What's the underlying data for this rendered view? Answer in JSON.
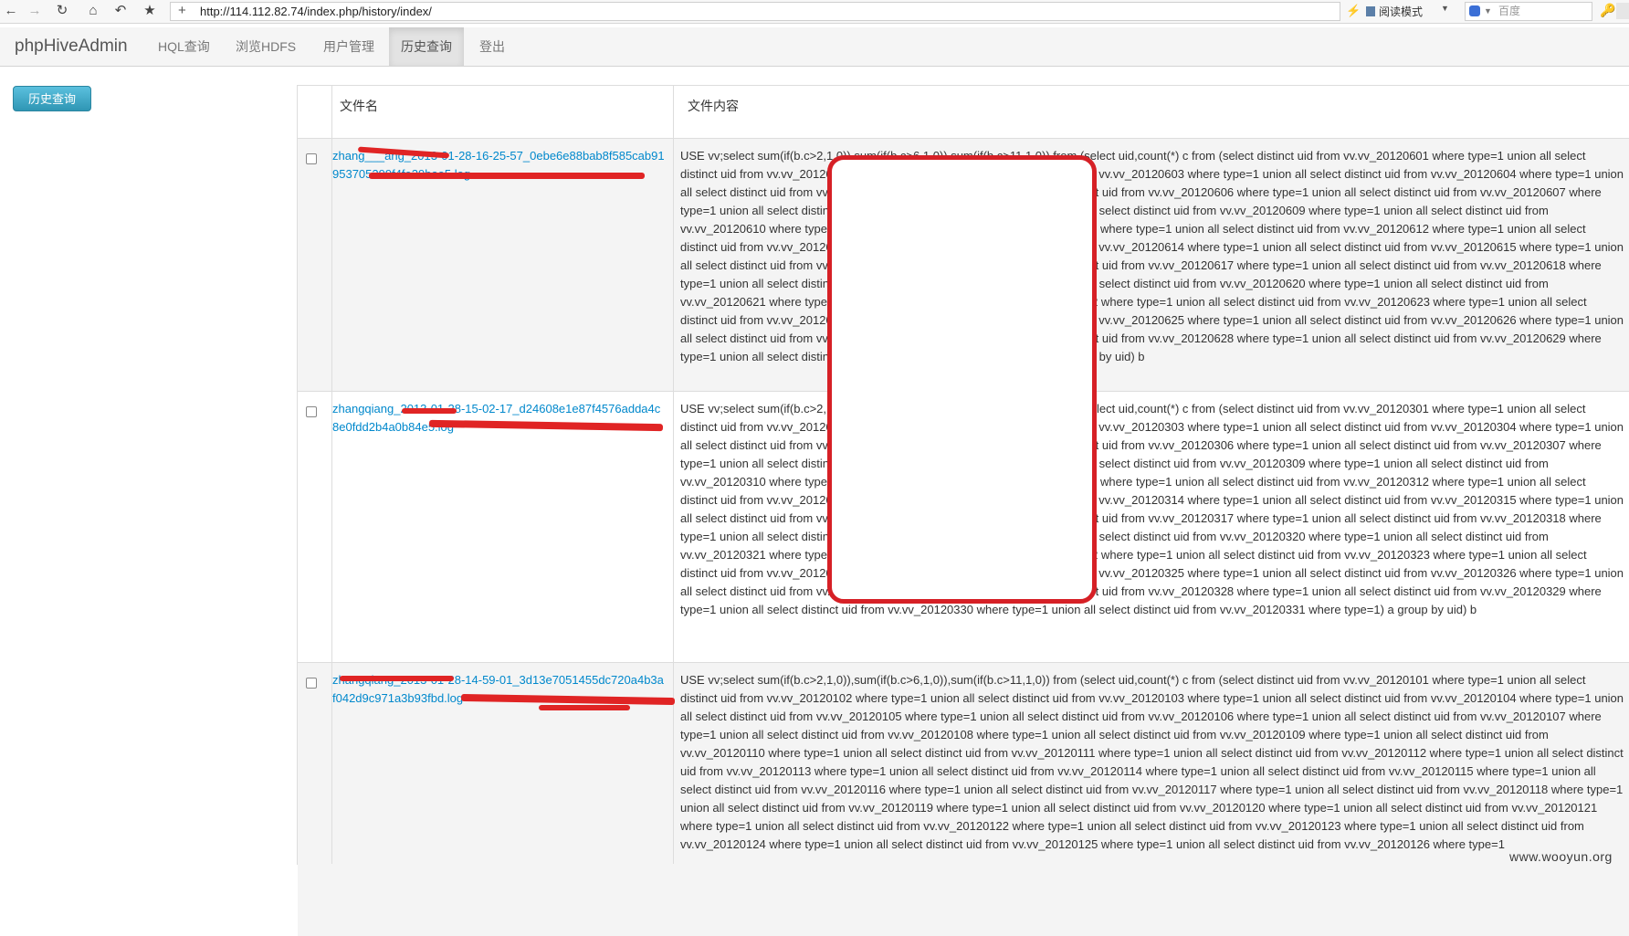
{
  "browser": {
    "url": "http://114.112.82.74/index.php/history/index/",
    "reader_mode_label": "阅读模式",
    "search_placeholder": "百度"
  },
  "navbar": {
    "brand": "phpHiveAdmin",
    "items": [
      {
        "label": "HQL查询",
        "active": false
      },
      {
        "label": "浏览HDFS",
        "active": false
      },
      {
        "label": "用户管理",
        "active": false
      },
      {
        "label": "历史查询",
        "active": true
      },
      {
        "label": "登出",
        "active": false
      }
    ]
  },
  "sidebar": {
    "button_label": "历史查询"
  },
  "table": {
    "headers": [
      "文件名",
      "文件内容"
    ],
    "rows": [
      {
        "file_name": "zhang___ang_2013-01-28-16-25-57_0ebe6e88bab8f585cab91953705299f4fe29bae5.log",
        "content": "USE vv;select sum(if(b.c>2,1,0)),sum(if(b.c>6,1,0)),sum(if(b.c>11,1,0)) from (select uid,count(*) c from (select distinct uid from vv.vv_20120601 where type=1 union all select distinct uid from vv.vv_20120602 where type=1 union all select distinct uid from vv.vv_20120603 where type=1 union all select distinct uid from vv.vv_20120604 where type=1 union all select distinct uid from vv.vv_20120605 where type=1 union all select distinct uid from vv.vv_20120606 where type=1 union all select distinct uid from vv.vv_20120607 where type=1 union all select distinct uid from vv.vv_20120608 where type=1 union all select distinct uid from vv.vv_20120609 where type=1 union all select distinct uid from vv.vv_20120610 where type=1 union all select distinct uid from vv.vv_20120611 where type=1 union all select distinct uid from vv.vv_20120612 where type=1 union all select distinct uid from vv.vv_20120613 where type=1 union all select distinct uid from vv.vv_20120614 where type=1 union all select distinct uid from vv.vv_20120615 where type=1 union all select distinct uid from vv.vv_20120616 where type=1 union all select distinct uid from vv.vv_20120617 where type=1 union all select distinct uid from vv.vv_20120618 where type=1 union all select distinct uid from vv.vv_20120619 where type=1 union all select distinct uid from vv.vv_20120620 where type=1 union all select distinct uid from vv.vv_20120621 where type=1 union all select distinct uid from vv.vv_20120622 where type=1 union all select distinct uid from vv.vv_20120623 where type=1 union all select distinct uid from vv.vv_20120624 where type=1 union all select distinct uid from vv.vv_20120625 where type=1 union all select distinct uid from vv.vv_20120626 where type=1 union all select distinct uid from vv.vv_20120627 where type=1 union all select distinct uid from vv.vv_20120628 where type=1 union all select distinct uid from vv.vv_20120629 where type=1 union all select distinct uid from vv.vv_20120630 where type=1) a group by uid) b"
      },
      {
        "file_name": "zhangqiang_2013-01-28-15-02-17_d24608e1e87f4576adda4c8e0fdd2b4a0b84e5.log",
        "content": "USE vv;select sum(if(b.c>2,1,0)),sum(if(b.c>6,1,0)),sum(if(b.c>11,1,0)) from (select uid,count(*) c from (select distinct uid from vv.vv_20120301 where type=1 union all select distinct uid from vv.vv_20120302 where type=1 union all select distinct uid from vv.vv_20120303 where type=1 union all select distinct uid from vv.vv_20120304 where type=1 union all select distinct uid from vv.vv_20120305 where type=1 union all select distinct uid from vv.vv_20120306 where type=1 union all select distinct uid from vv.vv_20120307 where type=1 union all select distinct uid from vv.vv_20120308 where type=1 union all select distinct uid from vv.vv_20120309 where type=1 union all select distinct uid from vv.vv_20120310 where type=1 union all select distinct uid from vv.vv_20120311 where type=1 union all select distinct uid from vv.vv_20120312 where type=1 union all select distinct uid from vv.vv_20120313 where type=1 union all select distinct uid from vv.vv_20120314 where type=1 union all select distinct uid from vv.vv_20120315 where type=1 union all select distinct uid from vv.vv_20120316 where type=1 union all select distinct uid from vv.vv_20120317 where type=1 union all select distinct uid from vv.vv_20120318 where type=1 union all select distinct uid from vv.vv_20120319 where type=1 union all select distinct uid from vv.vv_20120320 where type=1 union all select distinct uid from vv.vv_20120321 where type=1 union all select distinct uid from vv.vv_20120322 where type=1 union all select distinct uid from vv.vv_20120323 where type=1 union all select distinct uid from vv.vv_20120324 where type=1 union all select distinct uid from vv.vv_20120325 where type=1 union all select distinct uid from vv.vv_20120326 where type=1 union all select distinct uid from vv.vv_20120327 where type=1 union all select distinct uid from vv.vv_20120328 where type=1 union all select distinct uid from vv.vv_20120329 where type=1 union all select distinct uid from vv.vv_20120330 where type=1 union all select distinct uid from vv.vv_20120331 where type=1) a group by uid) b"
      },
      {
        "file_name": "zhangqiang_2013-01-28-14-59-01_3d13e7051455dc720a4b3af042d9c971a3b93fbd.log",
        "content": "USE vv;select sum(if(b.c>2,1,0)),sum(if(b.c>6,1,0)),sum(if(b.c>11,1,0)) from (select uid,count(*) c from (select distinct uid from vv.vv_20120101 where type=1 union all select distinct uid from vv.vv_20120102 where type=1 union all select distinct uid from vv.vv_20120103 where type=1 union all select distinct uid from vv.vv_20120104 where type=1 union all select distinct uid from vv.vv_20120105 where type=1 union all select distinct uid from vv.vv_20120106 where type=1 union all select distinct uid from vv.vv_20120107 where type=1 union all select distinct uid from vv.vv_20120108 where type=1 union all select distinct uid from vv.vv_20120109 where type=1 union all select distinct uid from vv.vv_20120110 where type=1 union all select distinct uid from vv.vv_20120111 where type=1 union all select distinct uid from vv.vv_20120112 where type=1 union all select distinct uid from vv.vv_20120113 where type=1 union all select distinct uid from vv.vv_20120114 where type=1 union all select distinct uid from vv.vv_20120115 where type=1 union all select distinct uid from vv.vv_20120116 where type=1 union all select distinct uid from vv.vv_20120117 where type=1 union all select distinct uid from vv.vv_20120118 where type=1 union all select distinct uid from vv.vv_20120119 where type=1 union all select distinct uid from vv.vv_20120120 where type=1 union all select distinct uid from vv.vv_20120121 where type=1 union all select distinct uid from vv.vv_20120122 where type=1 union all select distinct uid from vv.vv_20120123 where type=1 union all select distinct uid from vv.vv_20120124 where type=1 union all select distinct uid from vv.vv_20120125 where type=1 union all select distinct uid from vv.vv_20120126 where type=1"
      }
    ]
  },
  "watermark": "www.wooyun.org"
}
